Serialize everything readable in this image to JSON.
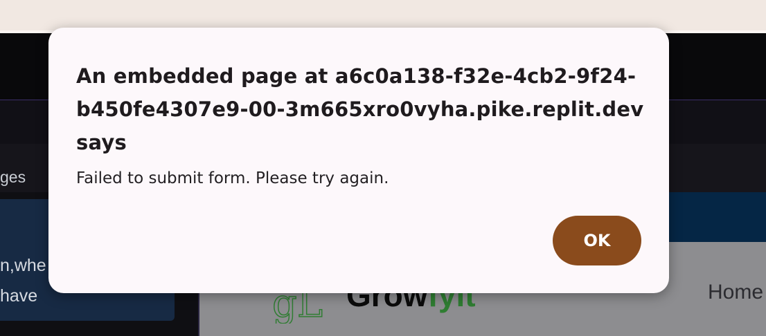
{
  "dialog": {
    "title": "An embedded page at a6c0a138-f32e-4cb2-9f24-b450fe4307e9-00-3m665xro0vyha.pike.replit.dev says",
    "message": "Failed to submit form. Please try again.",
    "ok_label": "OK",
    "button_color": "#8a4b1c"
  },
  "background": {
    "sidebar_tab_fragment": "ges",
    "text_fragment_1": "n,whe",
    "text_fragment_2": "have",
    "logo_text_main": "Grow",
    "logo_text_accent": "fyit",
    "logo_mark": "gL",
    "nav_home": "Home",
    "accent_color": "#2f7d32"
  }
}
